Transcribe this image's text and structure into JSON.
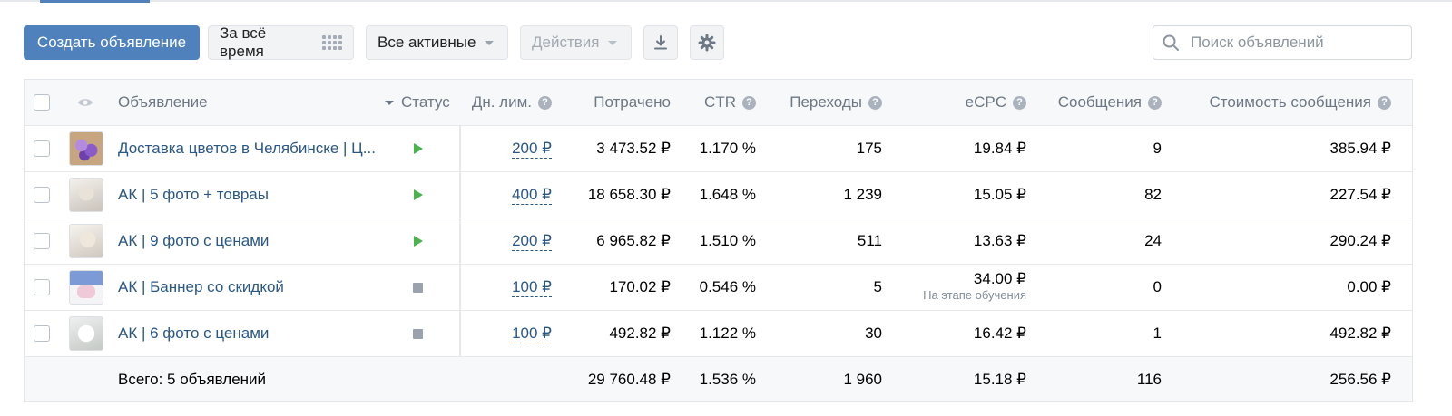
{
  "toolbar": {
    "create_label": "Создать объявление",
    "period_label": "За всё время",
    "status_filter_label": "Все активные",
    "actions_label": "Действия"
  },
  "search": {
    "placeholder": "Поиск объявлений",
    "value": ""
  },
  "icons": {
    "period": "grid-icon",
    "download": "download-icon",
    "settings": "gear-icon",
    "search": "search-icon",
    "visibility": "eye-icon",
    "help": "question-icon",
    "status_active": "play-icon",
    "status_stopped": "stop-icon"
  },
  "colors": {
    "accent": "#4f82bd",
    "link": "#2a5885",
    "active": "#4bb34b",
    "stopped": "#99a2ad"
  },
  "table": {
    "columns": {
      "ad": "Объявление",
      "status": "Статус",
      "daily_limit": "Дн. лим.",
      "spent": "Потрачено",
      "ctr": "CTR",
      "clicks": "Переходы",
      "ecpc": "eCPC",
      "messages": "Сообщения",
      "message_cost": "Стоимость сообщения"
    },
    "rows": [
      {
        "title": "Доставка цветов в Челябинске | Ц...",
        "status": "active",
        "daily_limit": "200 ₽",
        "spent": "3 473.52 ₽",
        "ctr": "1.170 %",
        "clicks": "175",
        "ecpc": "19.84 ₽",
        "ecpc_note": "",
        "messages": "9",
        "message_cost": "385.94 ₽"
      },
      {
        "title": "АК | 5 фото + товраы",
        "status": "active",
        "daily_limit": "400 ₽",
        "spent": "18 658.30 ₽",
        "ctr": "1.648 %",
        "clicks": "1 239",
        "ecpc": "15.05 ₽",
        "ecpc_note": "",
        "messages": "82",
        "message_cost": "227.54 ₽"
      },
      {
        "title": "АК | 9 фото с ценами",
        "status": "active",
        "daily_limit": "200 ₽",
        "spent": "6 965.82 ₽",
        "ctr": "1.510 %",
        "clicks": "511",
        "ecpc": "13.63 ₽",
        "ecpc_note": "",
        "messages": "24",
        "message_cost": "290.24 ₽"
      },
      {
        "title": "АК | Баннер со скидкой",
        "status": "stopped",
        "daily_limit": "100 ₽",
        "spent": "170.02 ₽",
        "ctr": "0.546 %",
        "clicks": "5",
        "ecpc": "34.00 ₽",
        "ecpc_note": "На этапе обучения",
        "messages": "0",
        "message_cost": "0.00 ₽"
      },
      {
        "title": "АК | 6 фото с ценами",
        "status": "stopped",
        "daily_limit": "100 ₽",
        "spent": "492.82 ₽",
        "ctr": "1.122 %",
        "clicks": "30",
        "ecpc": "16.42 ₽",
        "ecpc_note": "",
        "messages": "1",
        "message_cost": "492.82 ₽"
      }
    ],
    "total": {
      "label": "Всего: 5 объявлений",
      "spent": "29 760.48 ₽",
      "ctr": "1.536 %",
      "clicks": "1 960",
      "ecpc": "15.18 ₽",
      "messages": "116",
      "message_cost": "256.56 ₽"
    }
  }
}
